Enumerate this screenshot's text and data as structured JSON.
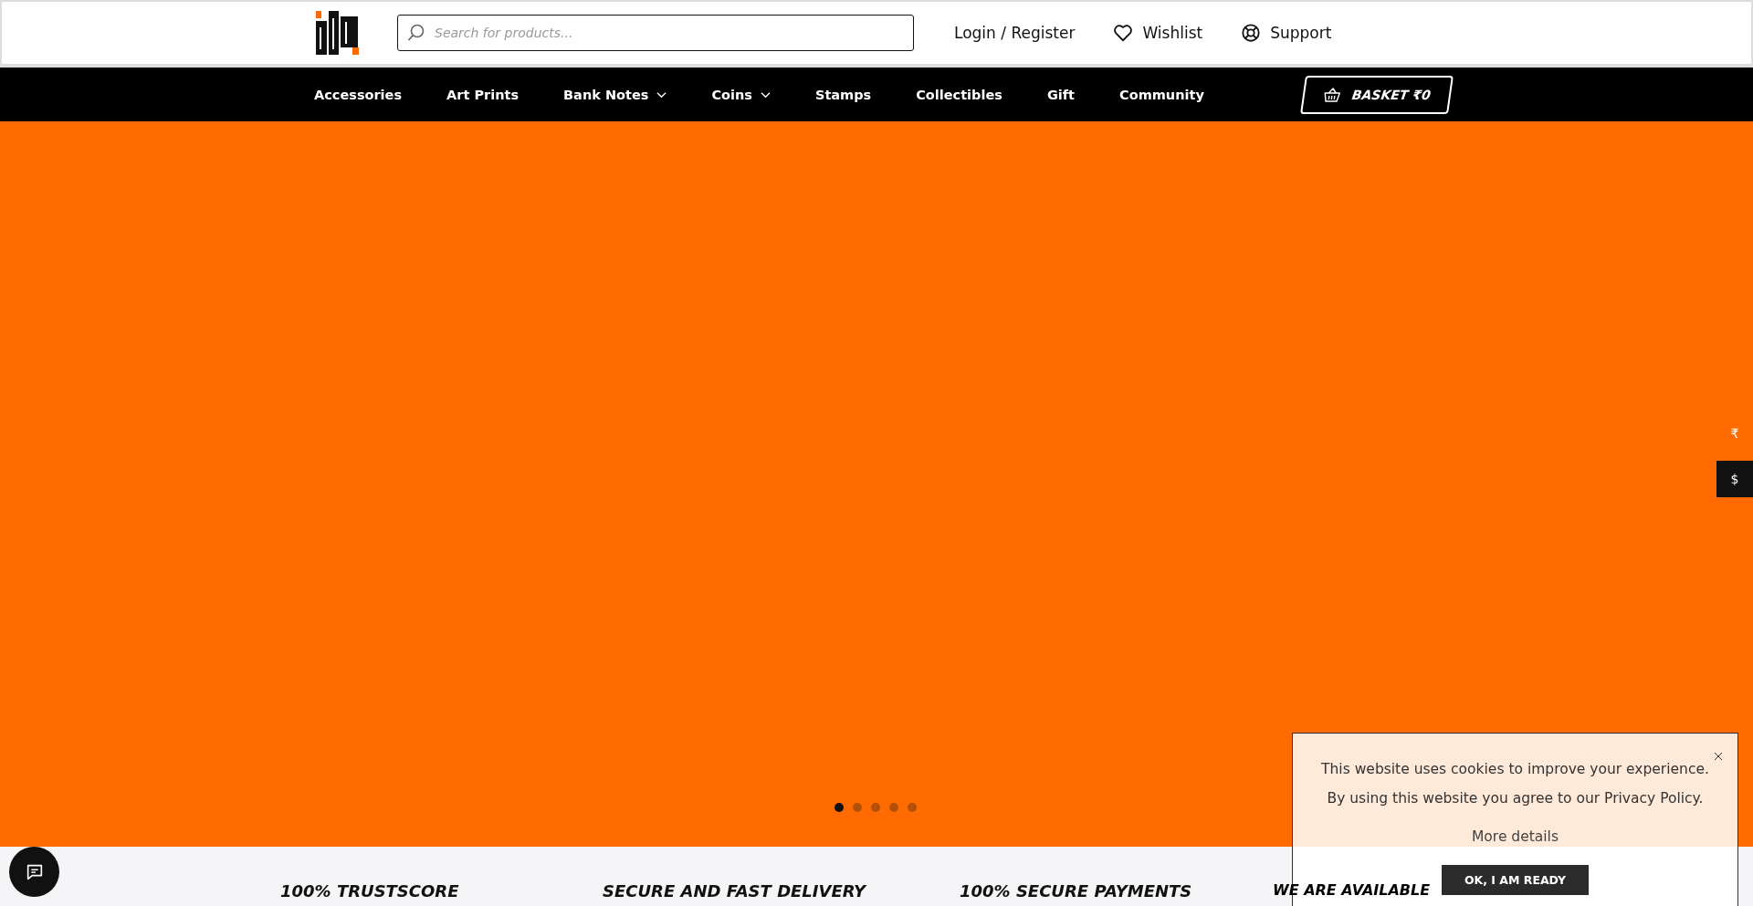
{
  "header": {
    "search": {
      "placeholder": "Search for products..."
    },
    "links": [
      {
        "kind": "account",
        "label": "Login / Register"
      },
      {
        "kind": "wishlist",
        "label": "Wishlist"
      },
      {
        "kind": "support",
        "label": "Support"
      }
    ]
  },
  "nav": {
    "items": [
      {
        "label": "Accessories",
        "dropdown": false
      },
      {
        "label": "Art Prints",
        "dropdown": false
      },
      {
        "label": "Bank Notes",
        "dropdown": true
      },
      {
        "label": "Coins",
        "dropdown": true
      },
      {
        "label": "Stamps",
        "dropdown": false
      },
      {
        "label": "Collectibles",
        "dropdown": false
      },
      {
        "label": "Gift",
        "dropdown": false
      },
      {
        "label": "Community",
        "dropdown": false
      }
    ],
    "basket": "BASKET ₹0"
  },
  "hero": {
    "slides": [
      {
        "selected": true
      },
      {
        "selected": false
      },
      {
        "selected": false
      },
      {
        "selected": false
      },
      {
        "selected": false
      }
    ]
  },
  "currencies": [
    {
      "symbol": "₹",
      "selected": false
    },
    {
      "symbol": "$",
      "selected": true
    }
  ],
  "features": [
    "100% TRUSTSCORE",
    "SECURE AND FAST DELIVERY",
    "100% SECURE PAYMENTS",
    "WE ARE AVAILABLE"
  ],
  "cookie_notice": {
    "lines": [
      "This website uses cookies to improve your experience.",
      "By using this website you agree to our Privacy Policy."
    ],
    "more": "More details",
    "accept": "OK, I AM READY"
  }
}
